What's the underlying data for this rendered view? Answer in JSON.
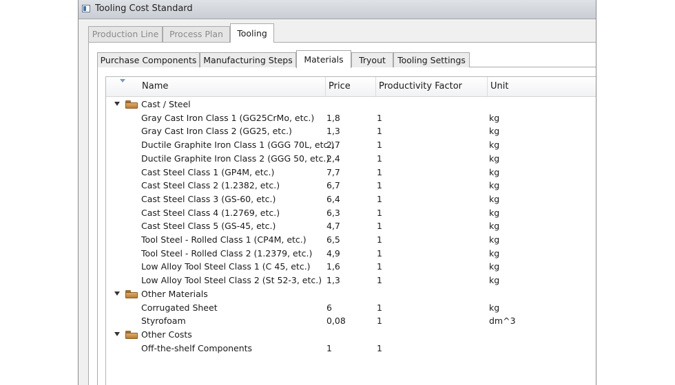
{
  "window": {
    "title": "Tooling Cost Standard"
  },
  "tabs_top": [
    {
      "label": "Production Line",
      "active": false
    },
    {
      "label": "Process Plan",
      "active": false
    },
    {
      "label": "Tooling",
      "active": true
    }
  ],
  "tabs_sub": [
    {
      "label": "Purchase Components",
      "active": false
    },
    {
      "label": "Manufacturing Steps",
      "active": false
    },
    {
      "label": "Materials",
      "active": true
    },
    {
      "label": "Tryout",
      "active": false
    },
    {
      "label": "Tooling Settings",
      "active": false
    }
  ],
  "columns": [
    "Name",
    "Price",
    "Productivity Factor",
    "Unit"
  ],
  "groups": [
    {
      "name": "Cast / Steel",
      "icon": "folder-icon",
      "items": [
        {
          "name": "Gray Cast Iron Class 1 (GG25CrMo, etc.)",
          "price": "1,8",
          "factor": "1",
          "unit": "kg"
        },
        {
          "name": "Gray Cast Iron Class 2 (GG25, etc.)",
          "price": "1,3",
          "factor": "1",
          "unit": "kg"
        },
        {
          "name": "Ductile Graphite Iron Class 1 (GGG 70L, etc.)",
          "price": "2,7",
          "factor": "1",
          "unit": "kg"
        },
        {
          "name": "Ductile Graphite Iron Class 2 (GGG 50, etc.)",
          "price": "2,4",
          "factor": "1",
          "unit": "kg"
        },
        {
          "name": "Cast Steel Class 1 (GP4M, etc.)",
          "price": "7,7",
          "factor": "1",
          "unit": "kg"
        },
        {
          "name": "Cast Steel Class 2 (1.2382, etc.)",
          "price": "6,7",
          "factor": "1",
          "unit": "kg"
        },
        {
          "name": "Cast Steel Class 3 (GS-60, etc.)",
          "price": "6,4",
          "factor": "1",
          "unit": "kg"
        },
        {
          "name": "Cast Steel Class 4 (1.2769, etc.)",
          "price": "6,3",
          "factor": "1",
          "unit": "kg"
        },
        {
          "name": "Cast Steel Class 5 (GS-45, etc.)",
          "price": "4,7",
          "factor": "1",
          "unit": "kg"
        },
        {
          "name": "Tool Steel - Rolled Class 1 (CP4M, etc.)",
          "price": "6,5",
          "factor": "1",
          "unit": "kg"
        },
        {
          "name": "Tool Steel - Rolled Class 2 (1.2379, etc.)",
          "price": "4,9",
          "factor": "1",
          "unit": "kg"
        },
        {
          "name": "Low Alloy Tool Steel Class 1 (C 45, etc.)",
          "price": "1,6",
          "factor": "1",
          "unit": "kg"
        },
        {
          "name": "Low Alloy Tool Steel Class 2 (St 52-3, etc.)",
          "price": "1,3",
          "factor": "1",
          "unit": "kg"
        }
      ]
    },
    {
      "name": "Other Materials",
      "icon": "folder-icon",
      "items": [
        {
          "name": "Corrugated Sheet",
          "price": "6",
          "factor": "1",
          "unit": "kg"
        },
        {
          "name": "Styrofoam",
          "price": "0,08",
          "factor": "1",
          "unit": "dm^3"
        }
      ]
    },
    {
      "name": "Other Costs",
      "icon": "folder-icon",
      "items": [
        {
          "name": "Off-the-shelf Components",
          "price": "1",
          "factor": "1",
          "unit": ""
        }
      ]
    }
  ]
}
